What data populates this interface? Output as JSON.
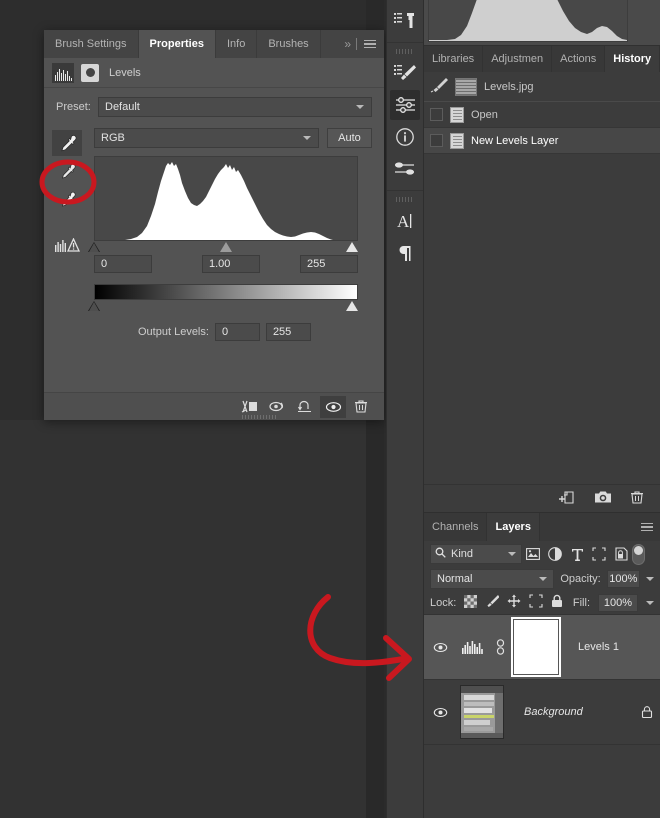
{
  "app": {
    "accent_red": "#c9181f",
    "panel_bg": "#535353",
    "dock_bg": "#3c3c3c"
  },
  "properties_panel": {
    "tabs": [
      {
        "label": "Brush Settings",
        "active": false
      },
      {
        "label": "Properties",
        "active": true
      },
      {
        "label": "Info",
        "active": false
      },
      {
        "label": "Brushes",
        "active": false
      }
    ],
    "overflow_icon": "double-chevron-right-icon",
    "menu_icon": "panel-menu-icon",
    "header": {
      "adjustment_icon": "levels-histogram-icon",
      "mask_icon": "layer-mask-icon",
      "title": "Levels"
    },
    "preset": {
      "label": "Preset:",
      "value": "Default"
    },
    "channel": {
      "value": "RGB",
      "auto_label": "Auto"
    },
    "eyedroppers": [
      {
        "name": "set-black-point-eyedropper",
        "active": true
      },
      {
        "name": "set-gray-point-eyedropper",
        "active": false
      },
      {
        "name": "set-white-point-eyedropper",
        "active": false
      }
    ],
    "clip_warning_icon": "histogram-warning-icon",
    "input_levels": {
      "black": "0",
      "gamma": "1.00",
      "white": "255"
    },
    "output_levels": {
      "label": "Output Levels:",
      "black": "0",
      "white": "255"
    },
    "footer_buttons": [
      {
        "name": "clip-to-layer-button",
        "icon": "clip-to-layer-icon",
        "active": false
      },
      {
        "name": "view-previous-state-button",
        "icon": "eye-previous-icon",
        "active": false
      },
      {
        "name": "reset-adjustment-button",
        "icon": "reset-arrow-icon",
        "active": false
      },
      {
        "name": "toggle-layer-visibility-button",
        "icon": "eye-icon",
        "active": true
      },
      {
        "name": "delete-adjustment-layer-button",
        "icon": "trash-icon",
        "active": false
      }
    ]
  },
  "dock": {
    "groups": [
      {
        "items": [
          {
            "name": "clone-source-icon",
            "active": false
          }
        ]
      },
      {
        "items": [
          {
            "name": "brush-settings-icon",
            "active": false
          },
          {
            "name": "adjustments-icon",
            "active": true
          },
          {
            "name": "info-icon",
            "active": false
          },
          {
            "name": "properties-icon",
            "active": false
          }
        ]
      },
      {
        "items": [
          {
            "name": "character-icon",
            "active": false
          },
          {
            "name": "paragraph-icon",
            "active": false
          }
        ]
      }
    ]
  },
  "histogram_preview": {
    "name": "histogram-panel-preview"
  },
  "history_panel": {
    "tabs": [
      {
        "label": "Libraries",
        "active": false
      },
      {
        "label": "Adjustmen",
        "active": false
      },
      {
        "label": "Actions",
        "active": false
      },
      {
        "label": "History",
        "active": true
      }
    ],
    "menu_icon": "panel-menu-icon",
    "snapshot": {
      "label": "Levels.jpg",
      "icon": "snapshot-brush-icon"
    },
    "states": [
      {
        "label": "Open",
        "selected": false
      },
      {
        "label": "New Levels Layer",
        "selected": true
      }
    ],
    "footer_buttons": [
      {
        "name": "new-document-from-state-button",
        "icon": "new-doc-icon"
      },
      {
        "name": "create-snapshot-button",
        "icon": "camera-icon"
      },
      {
        "name": "delete-state-button",
        "icon": "trash-icon"
      }
    ]
  },
  "layers_panel": {
    "tabs": [
      {
        "label": "Channels",
        "active": false
      },
      {
        "label": "Layers",
        "active": true
      }
    ],
    "menu_icon": "panel-menu-icon",
    "filter": {
      "kind_label": "Kind",
      "search_icon": "search-icon",
      "icons": [
        {
          "name": "filter-pixel-layers-icon"
        },
        {
          "name": "filter-adjustment-layers-icon"
        },
        {
          "name": "filter-type-layers-icon"
        },
        {
          "name": "filter-shape-layers-icon"
        },
        {
          "name": "filter-smart-object-icon"
        }
      ],
      "toggle": {
        "name": "filter-enable-toggle"
      }
    },
    "blend": {
      "mode": "Normal",
      "opacity_label": "Opacity:",
      "opacity_value": "100%"
    },
    "lock": {
      "label": "Lock:",
      "icons": [
        {
          "name": "lock-transparent-pixels-icon"
        },
        {
          "name": "lock-image-pixels-icon"
        },
        {
          "name": "lock-position-icon"
        },
        {
          "name": "lock-artboard-nesting-icon"
        },
        {
          "name": "lock-all-icon"
        }
      ],
      "fill_label": "Fill:",
      "fill_value": "100%"
    },
    "layers": [
      {
        "name": "Levels 1",
        "selected": true,
        "visible": true,
        "italic": false,
        "adjustment_icon": "levels-histogram-icon",
        "linked": true,
        "thumb": "white-mask",
        "locked": false
      },
      {
        "name": "Background",
        "selected": false,
        "visible": true,
        "italic": true,
        "adjustment_icon": null,
        "linked": false,
        "thumb": "photo",
        "locked": true
      }
    ]
  },
  "annotations": [
    {
      "name": "highlight-ellipse-black-point-eyedropper",
      "shape": "ellipse",
      "color": "#c9181f"
    },
    {
      "name": "pointer-arrow-to-layers-panel",
      "shape": "curved-arrow",
      "color": "#c9181f"
    }
  ]
}
